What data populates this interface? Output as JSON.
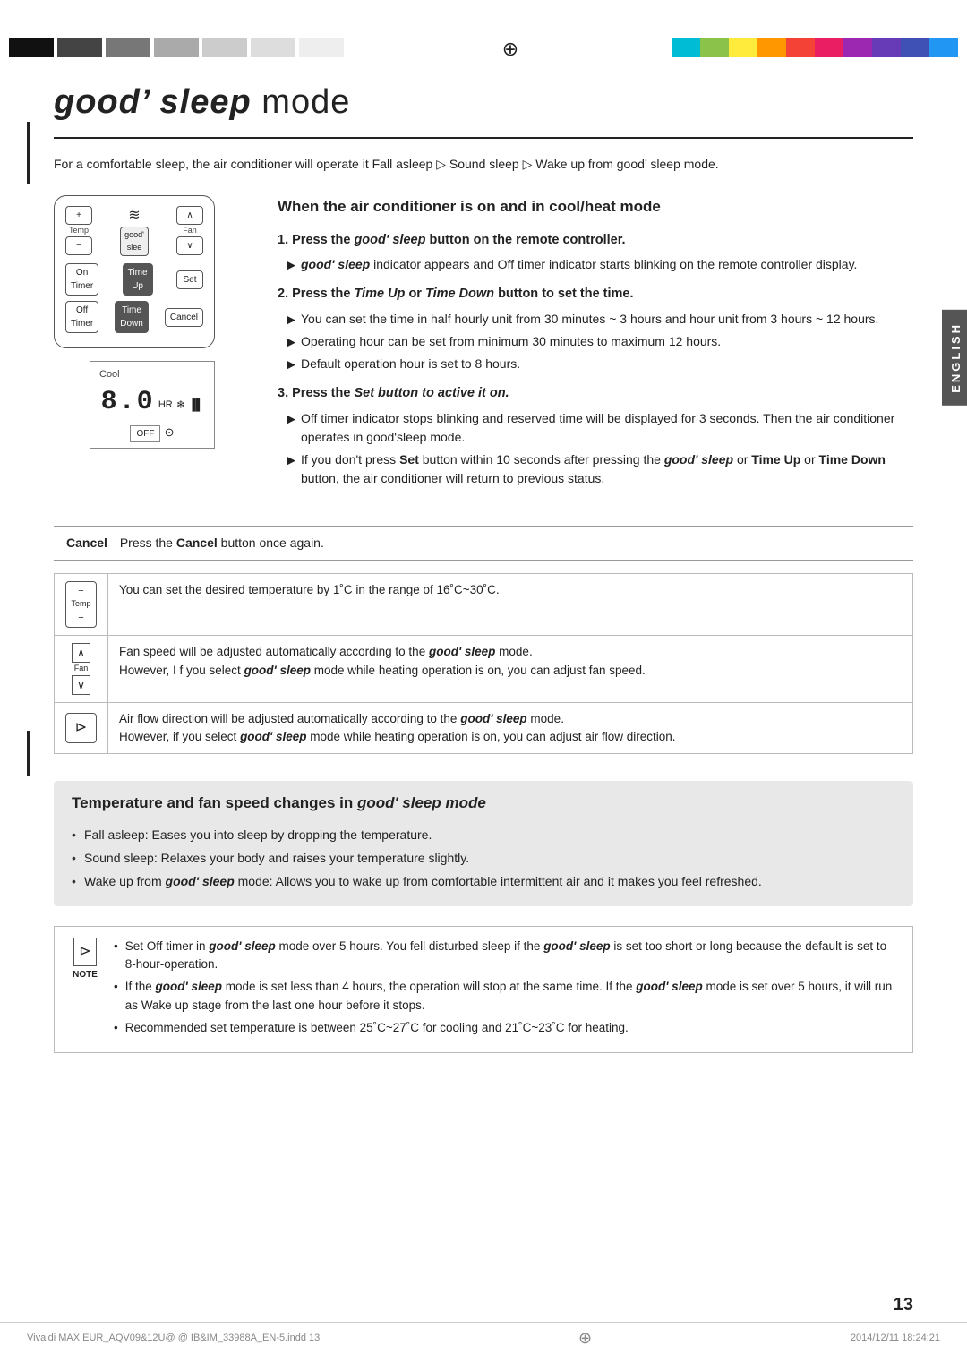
{
  "topbar": {
    "left_blocks": [
      "#222",
      "#555",
      "#888",
      "#aaa",
      "#ccc",
      "#ddd",
      "#eee"
    ],
    "right_colors": [
      "#00bcd4",
      "#8bc34a",
      "#ffeb3b",
      "#ff9800",
      "#f44336",
      "#e91e63",
      "#9c27b0",
      "#673ab7",
      "#3f51b5",
      "#2196f3"
    ]
  },
  "title": {
    "prefix": "good’ sleep",
    "suffix": "mode"
  },
  "intro": "For a comfortable sleep, the air conditioner will operate it Fall asleep ▷ Sound sleep ▷ Wake up from good’ sleep mode.",
  "section1_heading": "When the air conditioner is on and in cool/heat mode",
  "steps": [
    {
      "number": "1.",
      "title_plain": "Press the ",
      "title_bold": "good’ sleep",
      "title_end": " button on the remote controller.",
      "bullets": [
        "good’ sleep indicator appears and Off timer indicator starts blinking on the remote controller display."
      ]
    },
    {
      "number": "2.",
      "title_plain": "Press the ",
      "title_bold": "Time Up",
      "title_mid": " or ",
      "title_bold2": "Time Down",
      "title_end": " button to set the time.",
      "bullets": [
        "You can set the time in half hourly unit from 30 minutes ~ 3 hours and hour unit from 3 hours ~ 12 hours.",
        "Operating hour can be set from minimum 30 minutes to maximum 12 hours.",
        "Default operation hour is set to 8 hours."
      ]
    },
    {
      "number": "3.",
      "title_plain": "Press the ",
      "title_bold": "Set button to active it on.",
      "title_end": "",
      "bullets": [
        "Off timer indicator stops blinking and reserved time will be displayed for 3 seconds. Then the air conditioner operates in good’sleep mode.",
        "If you don’t press Set button within 10 seconds after pressing the good’ sleep or Time Up or Time Down button, the air conditioner will return to previous status."
      ]
    }
  ],
  "remote": {
    "cool_label": "Cool",
    "time_label": "8.0",
    "hr_label": "HR",
    "off_label": "OFF"
  },
  "cancel_text": {
    "label": "Cancel",
    "body": "Press the Cancel button once again."
  },
  "info_rows": [
    {
      "icon_type": "temp",
      "text": "You can set the desired temperature by 1˚C in the range of 16˚C~30˚C."
    },
    {
      "icon_type": "fan",
      "text": "Fan speed will be adjusted automatically according to the good’ sleep mode.\nHowever, I f you select good’ sleep mode while heating operation is on, you can adjust fan speed."
    },
    {
      "icon_type": "airflow",
      "text": "Air flow direction will be adjusted automatically according to the good’ sleep mode.\nHowever, if you select good’ sleep mode while heating operation is on, you can adjust air flow direction."
    }
  ],
  "temp_section": {
    "title_plain": "Temperature and fan speed changes in good’ sleep",
    "title_bold": "mode",
    "bullets": [
      "Fall asleep: Eases you into sleep by dropping the temperature.",
      "Sound sleep: Relaxes your body and raises your temperature slightly.",
      "Wake up from good’ sleep mode: Allows you to wake up from comfortable intermittent air and it makes you feel refreshed."
    ]
  },
  "note": {
    "items": [
      "Set Off timer in good’ sleep mode over 5 hours. You fell disturbed sleep if the good’ sleep is set too short or long because the default is set to 8-hour-operation.",
      "If the good’ sleep mode is set less than 4 hours, the operation will stop at the same time. If the good’ sleep mode is set over 5 hours, it will run as Wake up stage from the last one hour before it stops.",
      "Recommended set temperature is between 25˚C~27˚C for cooling and 21˚C~23˚C for heating."
    ]
  },
  "footer": {
    "left": "Vivaldi MAX EUR_AQV09&12U@ @ IB&IM_33988A_EN-5.indd  13",
    "right": "2014/12/11  18:24:21"
  },
  "page_number": "13",
  "side_label": "ENGLISH"
}
